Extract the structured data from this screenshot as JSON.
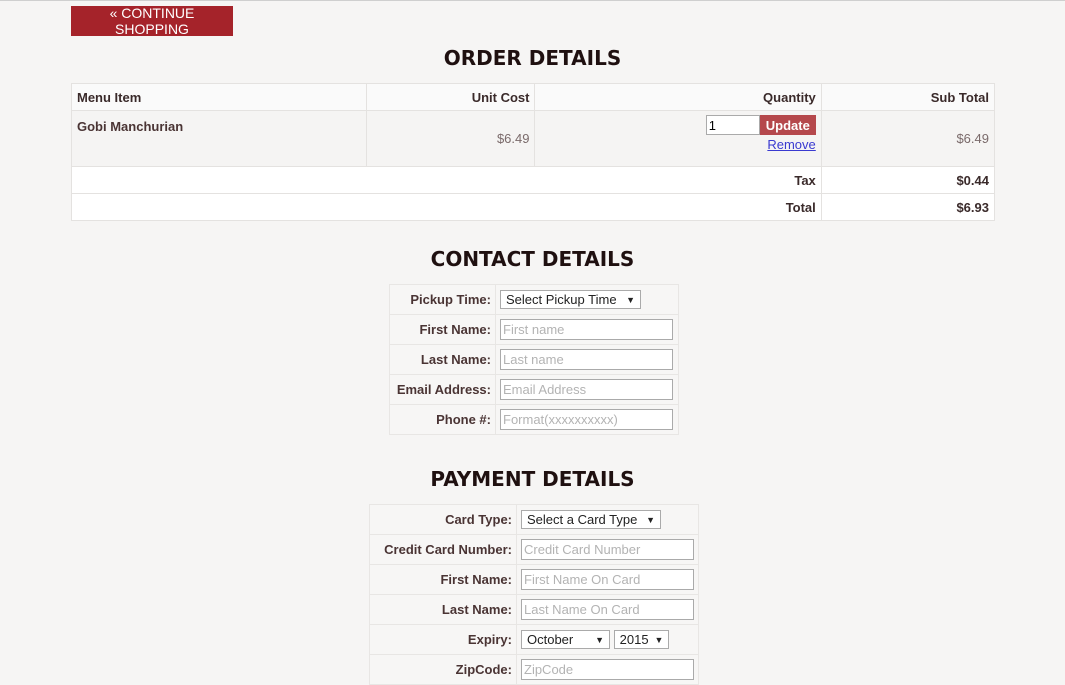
{
  "nav": {
    "continue_label": "« CONTINUE SHOPPING"
  },
  "order": {
    "title": "ORDER DETAILS",
    "headers": [
      "Menu Item",
      "Unit Cost",
      "Quantity",
      "Sub Total"
    ],
    "item": {
      "name": "Gobi Manchurian",
      "unit_cost": "$6.49",
      "quantity": "1",
      "subtotal": "$6.49"
    },
    "update_label": "Update",
    "remove_label": "Remove",
    "tax_label": "Tax",
    "tax_value": "$0.44",
    "total_label": "Total",
    "total_value": "$6.93"
  },
  "contact": {
    "title": "CONTACT DETAILS",
    "pickup_label": "Pickup Time:",
    "pickup_selected": "Select Pickup Time",
    "first_label": "First Name:",
    "first_placeholder": "First name",
    "last_label": "Last Name:",
    "last_placeholder": "Last name",
    "email_label": "Email Address:",
    "email_placeholder": "Email Address",
    "phone_label": "Phone #:",
    "phone_placeholder": "Format(xxxxxxxxxx)"
  },
  "payment": {
    "title": "PAYMENT DETAILS",
    "card_type_label": "Card Type:",
    "card_type_selected": "Select a Card Type",
    "cc_label": "Credit Card Number:",
    "cc_placeholder": "Credit Card Number",
    "first_label": "First Name:",
    "first_placeholder": "First Name On Card",
    "last_label": "Last Name:",
    "last_placeholder": "Last Name On Card",
    "expiry_label": "Expiry:",
    "expiry_month": "October",
    "expiry_year": "2015",
    "zip_label": "ZipCode:",
    "zip_placeholder": "ZipCode"
  },
  "colors": {
    "accent": "#a5232a",
    "update_button": "#b5484c",
    "link": "#3a3ad0"
  }
}
